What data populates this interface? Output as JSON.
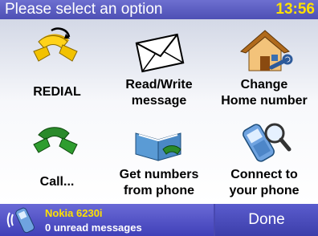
{
  "title_bar": {
    "title": "Please select an option",
    "clock": "13:56"
  },
  "options": [
    {
      "icon": "redial-handset-icon",
      "label_line1": "REDIAL",
      "label_line2": ""
    },
    {
      "icon": "envelope-icon",
      "label_line1": "Read/Write",
      "label_line2": "message"
    },
    {
      "icon": "home-wrench-icon",
      "label_line1": "Change",
      "label_line2": "Home number"
    },
    {
      "icon": "call-handset-icon",
      "label_line1": "Call...",
      "label_line2": ""
    },
    {
      "icon": "phonebook-icon",
      "label_line1": "Get numbers",
      "label_line2": "from phone"
    },
    {
      "icon": "phone-search-icon",
      "label_line1": "Connect to",
      "label_line2": "your phone"
    }
  ],
  "status_bar": {
    "device_name": "Nokia 6230i",
    "unread": "0 unread messages",
    "done_label": "Done"
  },
  "colors": {
    "title_bar": "#5b5dc4",
    "clock": "#ffe000",
    "device_name": "#ffe000",
    "bottom_bar": "#4848b0"
  }
}
